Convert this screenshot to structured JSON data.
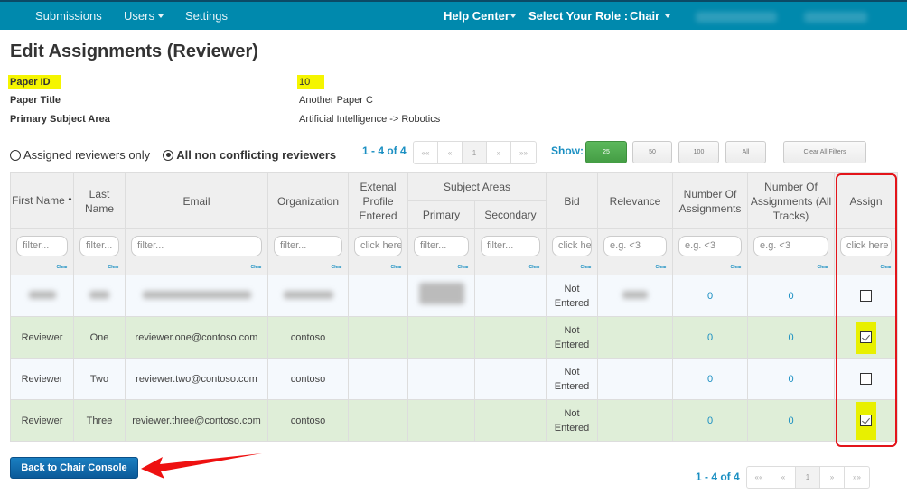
{
  "navbar": {
    "left_items": [
      {
        "label": "Submissions",
        "dropdown": false
      },
      {
        "label": "Users",
        "dropdown": true
      },
      {
        "label": "Settings",
        "dropdown": false
      }
    ],
    "help_center": "Help Center",
    "role_label": "Select Your Role :",
    "role_value": "Chair"
  },
  "page": {
    "title": "Edit Assignments (Reviewer)",
    "info": [
      {
        "label": "Paper ID",
        "value": "10",
        "highlighted": true
      },
      {
        "label": "Paper Title",
        "value": "Another Paper C",
        "highlighted": false
      },
      {
        "label": "Primary Subject Area",
        "value": "Artificial Intelligence -> Robotics",
        "highlighted": false
      }
    ]
  },
  "filters": {
    "radio_options": [
      {
        "label": "Assigned reviewers only",
        "selected": false
      },
      {
        "label": "All non conflicting reviewers",
        "selected": true
      }
    ],
    "count_text": "1 - 4 of 4",
    "pager": [
      "««",
      "«",
      "1",
      "»",
      "»»"
    ],
    "pager_current": "1",
    "show_label": "Show:",
    "show_options": [
      "25",
      "50",
      "100",
      "All"
    ],
    "show_selected": "25",
    "clear_all": "Clear All Filters"
  },
  "table": {
    "headers": {
      "first_name": "First Name",
      "last_name": "Last Name",
      "email": "Email",
      "organization": "Organization",
      "external_profile": "Extenal Profile Entered",
      "subject_areas": "Subject Areas",
      "primary": "Primary",
      "secondary": "Secondary",
      "bid": "Bid",
      "relevance": "Relevance",
      "num_assignments": "Number Of Assignments",
      "num_assignments_all": "Number Of Assignments (All Tracks)",
      "assign": "Assign"
    },
    "sort_icon": "arrow-up-icon",
    "filter_placeholders": {
      "first_name": "filter...",
      "last_name": "filter...",
      "email": "filter...",
      "organization": "filter...",
      "external_profile": "click here",
      "primary": "filter...",
      "secondary": "filter...",
      "bid": "click here",
      "relevance": "e.g. <3",
      "num_assignments": "e.g. <3",
      "num_assignments_all": "e.g. <3",
      "assign": "click here"
    },
    "clear_label": "Clear",
    "rows": [
      {
        "first": "",
        "last": "",
        "email": "",
        "org": "",
        "external": "",
        "primary": "",
        "secondary": "",
        "bid": "Not Entered",
        "relevance": "",
        "assignments": "0",
        "assignments_all": "0",
        "assigned": false,
        "redacted": true
      },
      {
        "first": "Reviewer",
        "last": "One",
        "email": "reviewer.one@contoso.com",
        "org": "contoso",
        "external": "",
        "primary": "",
        "secondary": "",
        "bid": "Not Entered",
        "relevance": "",
        "assignments": "0",
        "assignments_all": "0",
        "assigned": true,
        "redacted": false
      },
      {
        "first": "Reviewer",
        "last": "Two",
        "email": "reviewer.two@contoso.com",
        "org": "contoso",
        "external": "",
        "primary": "",
        "secondary": "",
        "bid": "Not Entered",
        "relevance": "",
        "assignments": "0",
        "assignments_all": "0",
        "assigned": false,
        "redacted": false
      },
      {
        "first": "Reviewer",
        "last": "Three",
        "email": "reviewer.three@contoso.com",
        "org": "contoso",
        "external": "",
        "primary": "",
        "secondary": "",
        "bid": "Not Entered",
        "relevance": "",
        "assignments": "0",
        "assignments_all": "0",
        "assigned": true,
        "redacted": false
      }
    ]
  },
  "footer": {
    "back_button": "Back to Chair Console",
    "count_text": "1 - 4 of 4",
    "pager": [
      "««",
      "«",
      "1",
      "»",
      "»»"
    ]
  },
  "colors": {
    "navbar": "#0089ad",
    "accent_blue": "#1a8fc2",
    "highlight_yellow": "#f5f500",
    "row_green": "#dfeed8",
    "annotation_red": "#e3141a",
    "show_active": "#5cb85c"
  }
}
